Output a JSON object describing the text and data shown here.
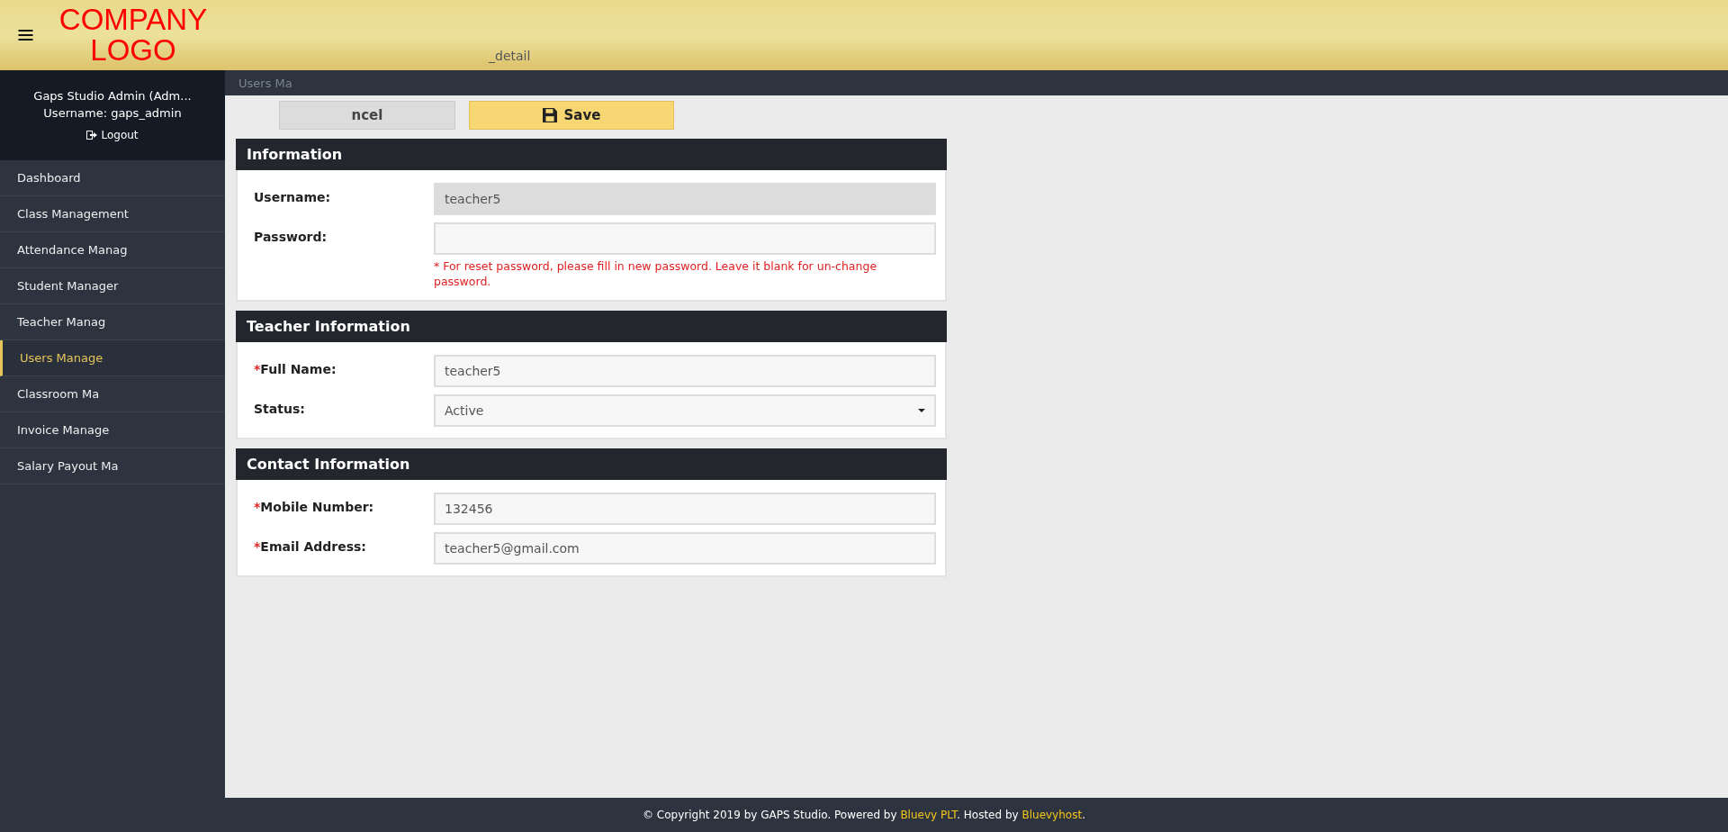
{
  "header": {
    "logo": "COMPANY LOGO",
    "page_title": "_detail"
  },
  "user_panel": {
    "name": "Gaps Studio Admin (Adm...",
    "username": "Username: gaps_admin",
    "logout": "Logout"
  },
  "menu": [
    {
      "label": "Dashboard",
      "selected": false
    },
    {
      "label": "Class Management",
      "selected": false
    },
    {
      "label": "Attendance Manag",
      "selected": false
    },
    {
      "label": "Student Manager",
      "selected": false
    },
    {
      "label": "Teacher Manag",
      "selected": false
    },
    {
      "label": "Users Manage",
      "selected": true
    },
    {
      "label": "Classroom Ma",
      "selected": false
    },
    {
      "label": "Invoice Manage",
      "selected": false
    },
    {
      "label": "Salary Payout Ma",
      "selected": false
    }
  ],
  "breadcrumb": "Users Ma",
  "buttons": [
    {
      "kind": "cancel",
      "label": "ncel"
    },
    {
      "kind": "save",
      "label": "Save"
    }
  ],
  "sections": [
    {
      "title": "Information",
      "fields": [
        {
          "label": "Username:",
          "kind": "text",
          "value": "teacher5",
          "disabled": true
        },
        {
          "label": "Password:",
          "kind": "text",
          "disabled": false,
          "note": "* For reset password, please fill in new password. Leave it blank for un-change password."
        }
      ]
    },
    {
      "title": "Teacher Information",
      "fields": [
        {
          "mark": "*",
          "label": "Full Name:",
          "kind": "text",
          "value": "teacher5",
          "disabled": false
        },
        {
          "label": "Status:",
          "kind": "select",
          "value": "Active",
          "disabled": false
        }
      ]
    },
    {
      "title": "Contact Information",
      "fields": [
        {
          "mark": "*",
          "label": "Mobile Number:",
          "kind": "text",
          "value": "132456",
          "disabled": false
        },
        {
          "mark": "*",
          "label": "Email Address:",
          "kind": "text",
          "value": "teacher5@gmail.com",
          "disabled": false
        }
      ]
    }
  ],
  "footer": {
    "text_1": "© Copyright 2019 by GAPS Studio. Powered by",
    "link_1": "Bluevy PLT",
    "text_2": ". Hosted by",
    "link_2": "Bluevyhost",
    "text_3": "."
  }
}
